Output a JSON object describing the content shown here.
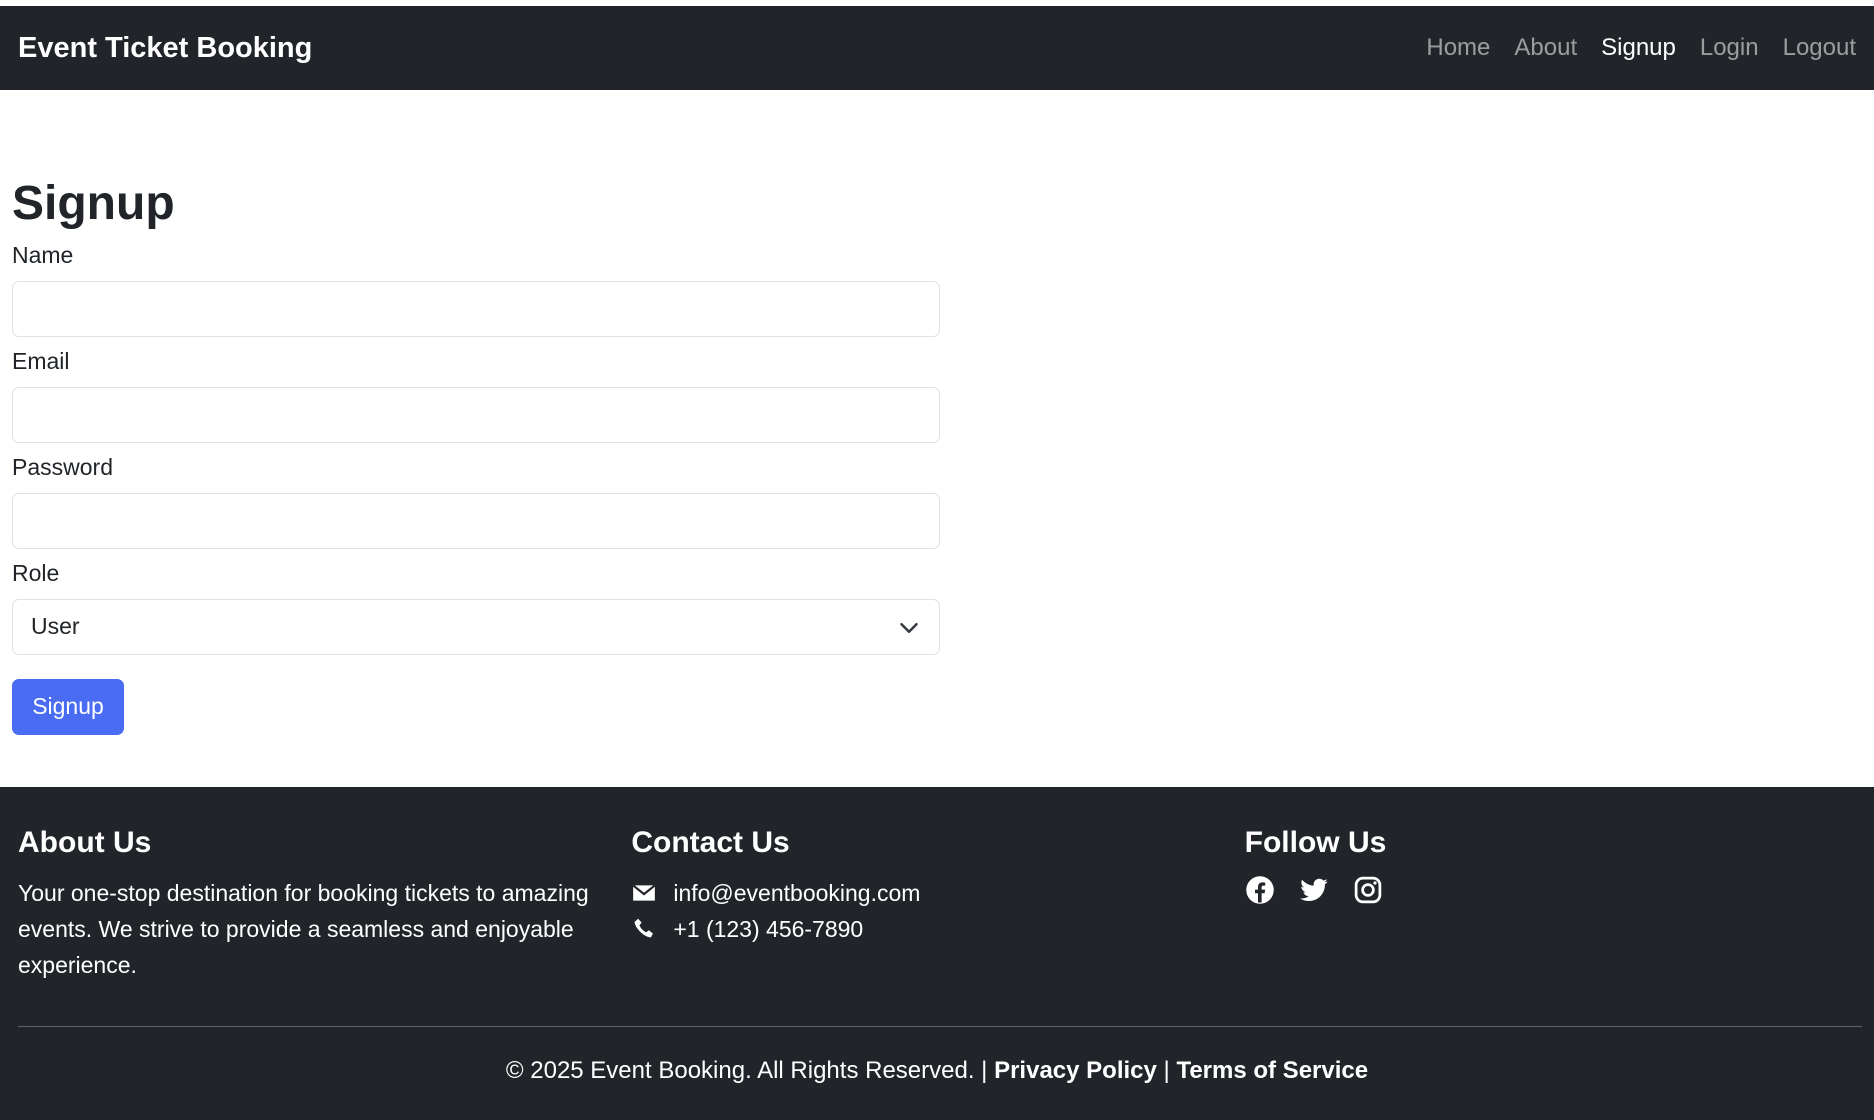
{
  "navbar": {
    "brand": "Event Ticket Booking",
    "links": [
      "Home",
      "About",
      "Signup",
      "Login",
      "Logout"
    ]
  },
  "form": {
    "title": "Signup",
    "name_label": "Name",
    "email_label": "Email",
    "password_label": "Password",
    "role_label": "Role",
    "role_value": "User",
    "submit_label": "Signup"
  },
  "footer": {
    "about_title": "About Us",
    "about_text": "Your one-stop destination for booking tickets to amazing events. We strive to provide a seamless and enjoyable experience.",
    "contact_title": "Contact Us",
    "email": "info@eventbooking.com",
    "phone": "+1 (123) 456-7890",
    "follow_title": "Follow Us",
    "social_icons": [
      "facebook-icon",
      "twitter-icon",
      "instagram-icon"
    ],
    "copyright": "© 2025 Event Booking. All Rights Reserved. |",
    "privacy": "Privacy Policy",
    "separator": "|",
    "terms": "Terms of Service"
  },
  "colors": {
    "navbar_bg": "#212529",
    "primary": "#4a6cf2"
  }
}
